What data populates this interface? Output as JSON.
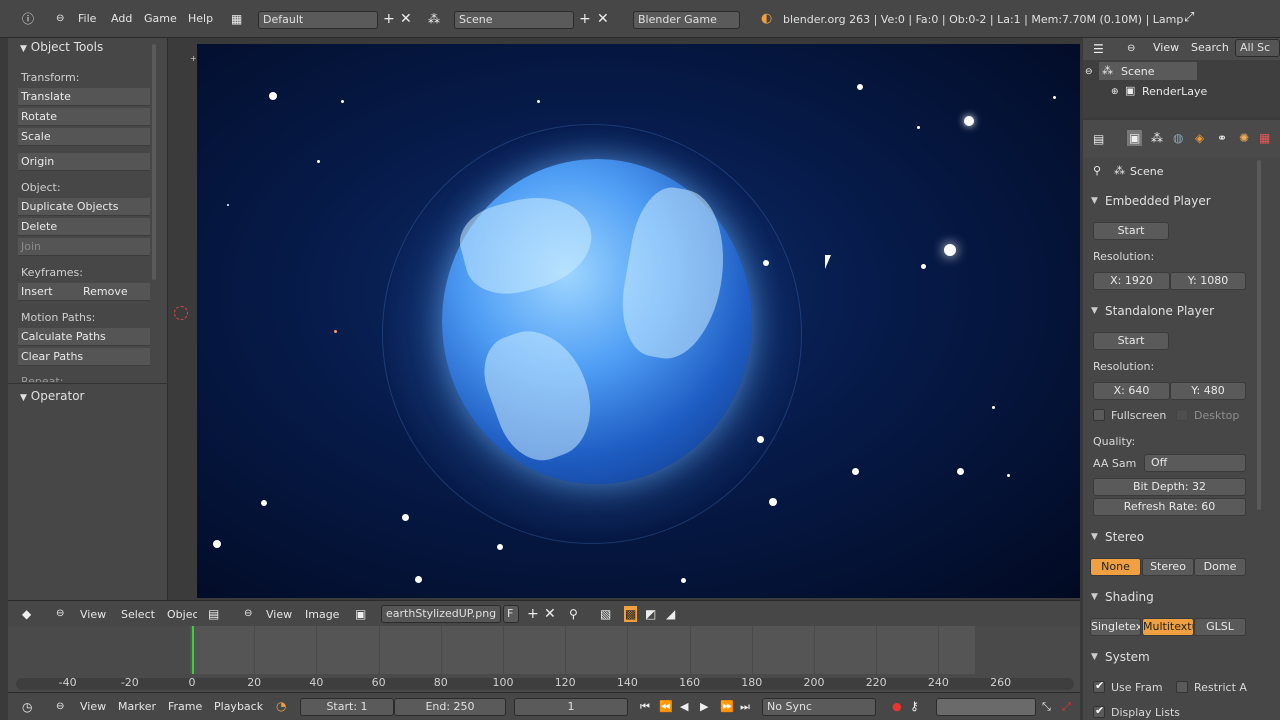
{
  "topbar": {
    "menus": [
      "File",
      "Add",
      "Game",
      "Help"
    ],
    "screen_layout": "Default",
    "scene": "Scene",
    "engine": "Blender Game",
    "info": "blender.org 263 | Ve:0 | Fa:0 | Ob:0-2 | La:1 | Mem:7.70M (0.10M) | Lamp"
  },
  "tool_shelf": {
    "title": "Object Tools",
    "transform_label": "Transform:",
    "translate": "Translate",
    "rotate": "Rotate",
    "scale": "Scale",
    "origin": "Origin",
    "object_label": "Object:",
    "duplicate": "Duplicate Objects",
    "delete": "Delete",
    "join": "Join",
    "keyframes_label": "Keyframes:",
    "insert": "Insert",
    "remove": "Remove",
    "motion_label": "Motion Paths:",
    "calc_paths": "Calculate Paths",
    "clear_paths": "Clear Paths",
    "repeat_label": "Repeat:",
    "operator": "Operator"
  },
  "view3d_header": {
    "view": "View",
    "select": "Select",
    "object": "Objec"
  },
  "image_header": {
    "view": "View",
    "image": "Image",
    "filename": "earthStylizedUP.png",
    "fake_user": "F"
  },
  "timeline": {
    "ticks": [
      "-40",
      "-20",
      "0",
      "20",
      "40",
      "60",
      "80",
      "100",
      "120",
      "140",
      "160",
      "180",
      "200",
      "220",
      "240",
      "260"
    ],
    "current_frame": 1,
    "view": "View",
    "marker": "Marker",
    "frame": "Frame",
    "playback": "Playback",
    "start": "Start: 1",
    "end": "End: 250",
    "frame_field": "1",
    "sync": "No Sync"
  },
  "outliner": {
    "view": "View",
    "search": "Search",
    "filter": "All Sc",
    "scene": "Scene",
    "render_layers": "RenderLaye"
  },
  "properties": {
    "context": "Scene",
    "embedded_player": "Embedded Player",
    "embedded_start": "Start",
    "resolution_label": "Resolution:",
    "emb_x": "X: 1920",
    "emb_y": "Y: 1080",
    "standalone_player": "Standalone Player",
    "standalone_start": "Start",
    "resolution_label2": "Resolution:",
    "sa_x": "X: 640",
    "sa_y": "Y: 480",
    "fullscreen": "Fullscreen",
    "desktop": "Desktop",
    "quality_label": "Quality:",
    "aa_label": "AA Sam",
    "aa_value": "Off",
    "bit_depth": "Bit Depth: 32",
    "refresh": "Refresh Rate: 60",
    "stereo": "Stereo",
    "stereo_opts": [
      "None",
      "Stereo",
      "Dome"
    ],
    "shading": "Shading",
    "shading_opts": [
      "Singletext",
      "Multitextu",
      "GLSL"
    ],
    "system": "System",
    "use_frame": "Use Fram",
    "restrict": "Restrict A",
    "display_lists": "Display Lists"
  },
  "colors": {
    "accent": "#f0a040",
    "playhead": "#3bd13b"
  }
}
